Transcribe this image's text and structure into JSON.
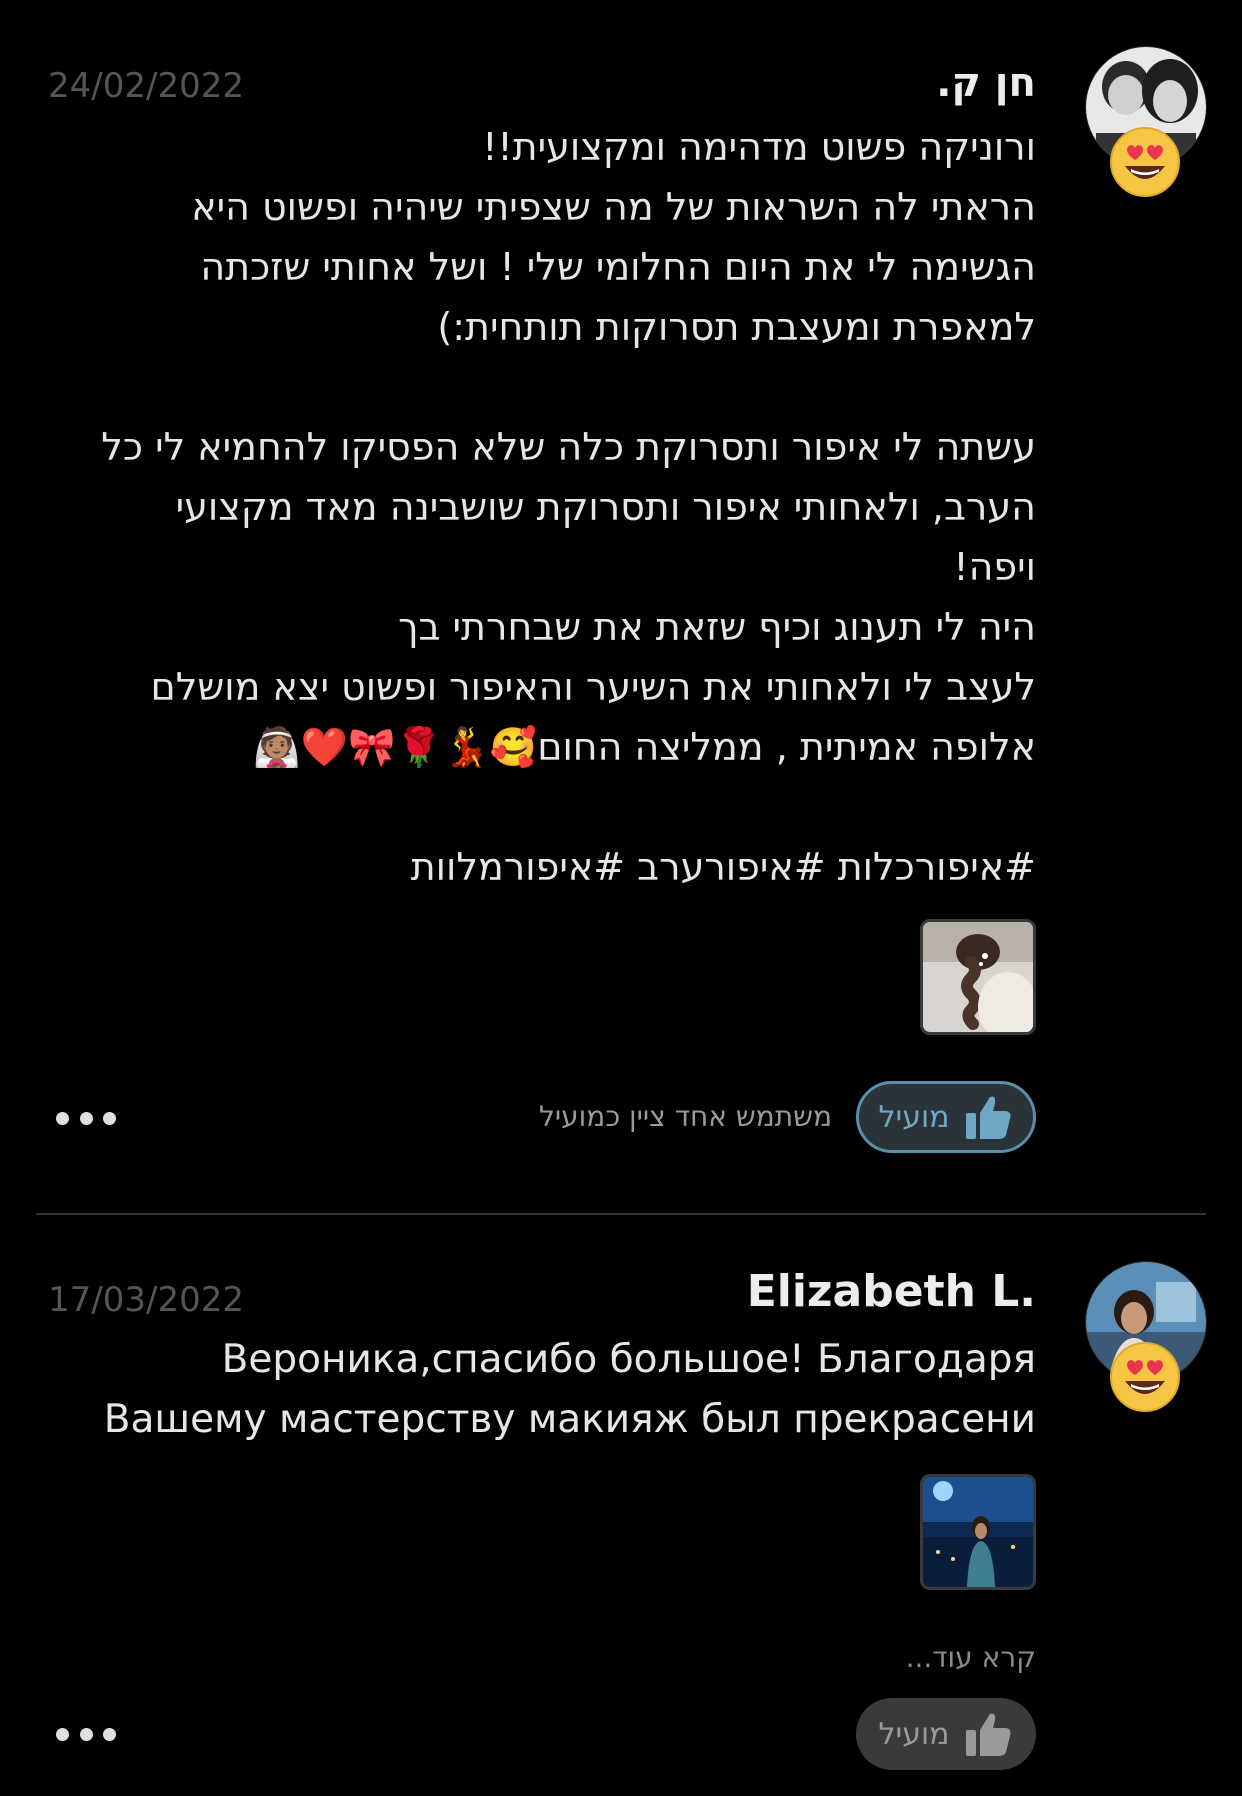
{
  "reviews": [
    {
      "name": "חן ק.",
      "date": "24/02/2022",
      "reaction_icon": "heart-eyes-emoji",
      "body_lines": [
        "ורוניקה פשוט מדהימה ומקצועית!!",
        "הראתי לה השראות של מה שצפיתי שיהיה ופשוט היא",
        "הגשימה לי את היום החלומי שלי ! ושל אחותי שזכתה",
        "למאפרת ומעצבת תסרוקות תותחית:)",
        "",
        "עשתה לי איפור ותסרוקת כלה שלא הפסיקו להחמיא לי כל",
        "הערב, ולאחותי איפור ותסרוקת שושבינה מאד מקצועי",
        "ויפה!",
        "היה לי תענוג וכיף שזאת את שבחרתי בך",
        "לעצב לי ולאחותי את השיער והאיפור ופשוט יצא מושלם",
        "אלופה אמיתית , ממליצה החום🥰💃🌹🎀❤️👰🏽",
        "",
        "#איפורכלות #איפורערב #איפורמלוות"
      ],
      "helpful_label": "מועיל",
      "helpful_count_text": "משתמש אחד ציין כמועיל",
      "helpful_active": true
    },
    {
      "name": "Elizabeth L.",
      "date": "17/03/2022",
      "reaction_icon": "heart-eyes-emoji",
      "body_lines": [
        "Вероника,спасибо большое! Благодаря",
        "Вашему мастерству макияж был прекрасени"
      ],
      "read_more": "קרא עוד...",
      "helpful_label": "מועיל",
      "helpful_active": false
    }
  ],
  "colors": {
    "background": "#000000",
    "helpful_active_border": "#5a8fa8",
    "helpful_active_text": "#6fa8c4",
    "helpful_inactive_bg": "#3a3a3a",
    "divider": "#333333"
  }
}
